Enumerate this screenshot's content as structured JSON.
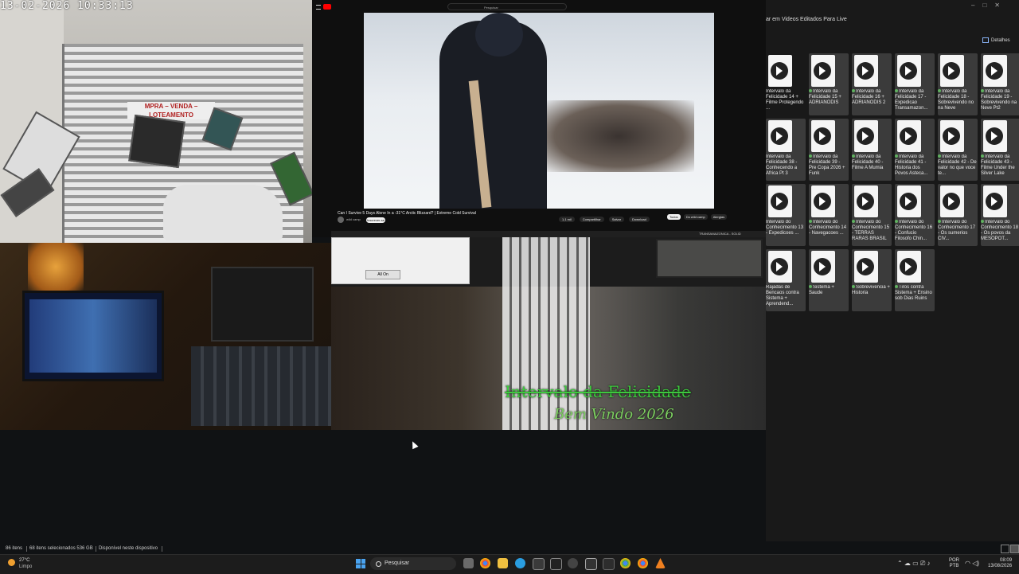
{
  "camera": {
    "timestamp": "13-02-2026  10:33:13",
    "sign_text": "MPRA – VENDA – LOTEAMENTO"
  },
  "youtube": {
    "search_placeholder": "Pesquisar",
    "video_title": "Can I Survive 5 Days Alone In a -31°C Arctic Blizzard? | Extreme Cold Survival",
    "channel": "wild camp",
    "subscribe_label": "Inscrever-se",
    "actions": [
      "1,1 mil",
      "Compartilhar",
      "Salvar",
      "Download"
    ],
    "chips": [
      "Todos",
      "Do wild camp",
      "Alergias"
    ]
  },
  "second_window": {
    "button_label": "All On",
    "overlay_line1": "Intervalo da Felicidade",
    "overlay_line2": "Bem Vindo 2026",
    "tab_label": "TRANSAMAZONICA - SOLID"
  },
  "explorer": {
    "search_text": "ar em Videos Editados Para Live",
    "details_label": "Detalhes",
    "items": [
      "Intervalo da Felicidade 14 + Filme Protegendo ...",
      "Intervalo da Felicidade 15 + ADRIANODIS",
      "Intervalo da Felicidade 16 + ADRIANODIS 2",
      "Intervalo da Felicidade 17 - Expedicao Transamazon...",
      "Intervalo da Felicidade 18 - Sobrevivendo no na Neve",
      "Intervalo da Felicidade 19 - Sobrevivendo na Neve Pt2",
      "Intervalo da Felicidade 38 - Conhecendo a Africa Pt 3",
      "Intervalo da Felicidade 39 - Pre Copa 2026 + Funk",
      "Intervalo da Felicidade 40 - Filme A Mumia",
      "Intervalo da Felicidade 41 - Historia dos Povos Asteca...",
      "Intervalo da Felicidade 42 - De valor no que voce te...",
      "Intervalo da Felicidade 43 - Filme Under the Silver Lake",
      "Intervalo do Conhecimento 13 - Expedicoes ...",
      "Intervalo do Conhecimento 14 - Navegacoes ...",
      "Intervalo do Conhecimento 15 - TERRAS RARAS BRASIL",
      "Intervalo do Conhecimento 16 - Confucio Filosofo Chin...",
      "Intervalo do Conhecimento 17 - Os sumerios CIV...",
      "Intervalo do Conhecimento 18 - Os povos da MESOPOT...",
      "Rajadas de Bencaos contra Sistema + Aprendend...",
      "Sistema + Saude",
      "Sobrevivencia + Historia",
      "Tiros contra Sistema + Ensino sob Dias Ruins"
    ]
  },
  "status_bar": {
    "items_count": "86 itens",
    "selected": "68 itens selecionados  536 GB",
    "availability": "Disponível neste dispositivo"
  },
  "taskbar": {
    "temperature": "27°C",
    "condition": "Limpo",
    "search_label": "Pesquisar",
    "language_line1": "POR",
    "language_line2": "PTB",
    "time": "08:09",
    "date": "13/08/2026"
  },
  "colors": {
    "accent": "#4aa3f0",
    "youtube_red": "#ff0000",
    "overlay_green": "#3ec93e"
  }
}
